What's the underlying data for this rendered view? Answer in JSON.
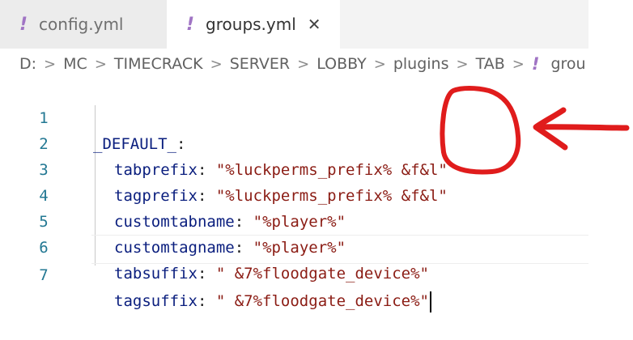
{
  "tabs": [
    {
      "icon": "!",
      "label": "config.yml",
      "active": false
    },
    {
      "icon": "!",
      "label": "groups.yml",
      "active": true,
      "close": "✕"
    }
  ],
  "breadcrumb": {
    "items": [
      "D:",
      "MC",
      "TIMECRACK",
      "SERVER",
      "LOBBY",
      "plugins",
      "TAB"
    ],
    "separator": ">",
    "file_icon": "!",
    "file_partial": "grou"
  },
  "editor": {
    "lines": [
      {
        "num": "1",
        "key": "_DEFAULT_",
        "colon": ":",
        "value": ""
      },
      {
        "num": "2",
        "key": "tabprefix",
        "colon": ":",
        "value": "\"%luckperms_prefix% &f&l\""
      },
      {
        "num": "3",
        "key": "tagprefix",
        "colon": ":",
        "value": "\"%luckperms_prefix% &f&l\""
      },
      {
        "num": "4",
        "key": "customtabname",
        "colon": ":",
        "value": "\"%player%\""
      },
      {
        "num": "5",
        "key": "customtagname",
        "colon": ":",
        "value": "\"%player%\""
      },
      {
        "num": "6",
        "key": "tabsuffix",
        "colon": ":",
        "value": "\" &7%floodgate_device%\""
      },
      {
        "num": "7",
        "key": "tagsuffix",
        "colon": ":",
        "value": "\" &7%floodgate_device%\""
      }
    ]
  },
  "colors": {
    "annotation": "#e01c1c",
    "yml_icon": "#a074c4",
    "line_number": "#237893",
    "key": "#0a1e7e",
    "string": "#8b1c14"
  }
}
